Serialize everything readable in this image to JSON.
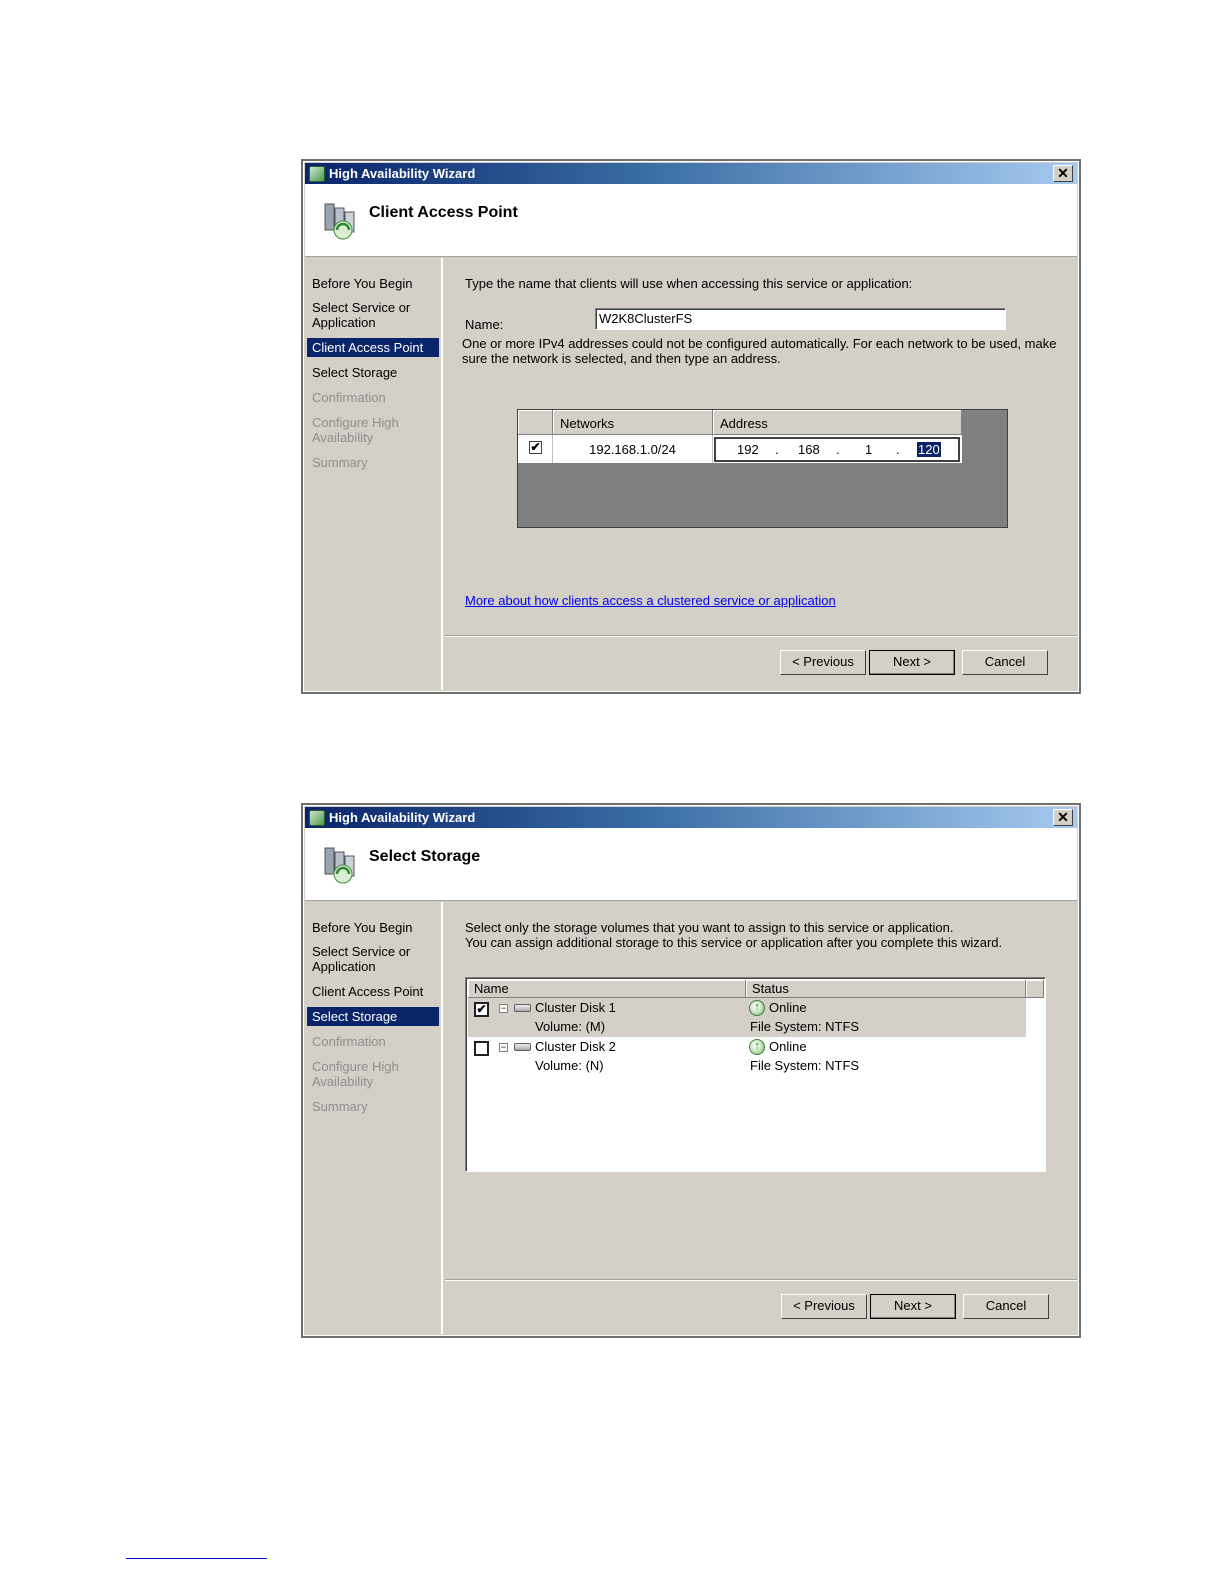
{
  "dialog1": {
    "window_title": "High Availability Wizard",
    "close_glyph": "✕",
    "header_title": "Client Access Point",
    "steps": [
      {
        "label": "Before You Begin",
        "state": "normal"
      },
      {
        "label": "Select Service or Application",
        "state": "normal"
      },
      {
        "label": "Client Access Point",
        "state": "active"
      },
      {
        "label": "Select Storage",
        "state": "normal"
      },
      {
        "label": "Confirmation",
        "state": "disabled"
      },
      {
        "label": "Configure High Availability",
        "state": "disabled"
      },
      {
        "label": "Summary",
        "state": "disabled"
      }
    ],
    "instruction": "Type the name that clients will use when accessing this service or application:",
    "name_label": "Name:",
    "name_value": "W2K8ClusterFS",
    "ipv4_note": "One or more IPv4 addresses could not be configured automatically.  For each network to be used, make sure the network is selected, and then type an address.",
    "grid": {
      "col_networks": "Networks",
      "col_address": "Address",
      "row": {
        "checked": "✔",
        "network": "192.168.1.0/24",
        "ip": [
          "192",
          "168",
          "1",
          "120"
        ],
        "dot": "."
      }
    },
    "help_link": "More about how clients access a clustered service or application",
    "buttons": {
      "previous": "< Previous",
      "next": "Next >",
      "cancel": "Cancel"
    }
  },
  "dialog2": {
    "window_title": "High Availability Wizard",
    "close_glyph": "✕",
    "header_title": "Select Storage",
    "steps": [
      {
        "label": "Before You Begin",
        "state": "normal"
      },
      {
        "label": "Select Service or Application",
        "state": "normal"
      },
      {
        "label": "Client Access Point",
        "state": "normal"
      },
      {
        "label": "Select Storage",
        "state": "active"
      },
      {
        "label": "Confirmation",
        "state": "disabled"
      },
      {
        "label": "Configure High Availability",
        "state": "disabled"
      },
      {
        "label": "Summary",
        "state": "disabled"
      }
    ],
    "instruction_line1": "Select only the storage volumes that you want to assign to this service or application.",
    "instruction_line2": "You can assign additional storage to this service or application after you complete this wizard.",
    "list": {
      "col_name": "Name",
      "col_status": "Status",
      "expander_glyph": "−",
      "online_glyph": "↑",
      "rows": [
        {
          "checked": "✔",
          "name": "Cluster Disk 1",
          "volume": "Volume: (M)",
          "status": "Online",
          "fs": "File System: NTFS"
        },
        {
          "checked": "",
          "name": "Cluster Disk 2",
          "volume": "Volume: (N)",
          "status": "Online",
          "fs": "File System: NTFS"
        }
      ]
    },
    "buttons": {
      "previous": "< Previous",
      "next": "Next >",
      "cancel": "Cancel"
    }
  },
  "colors": {
    "selection": "#0a246a",
    "dialog_bg": "#d4d0c8",
    "link": "#0000ee"
  }
}
